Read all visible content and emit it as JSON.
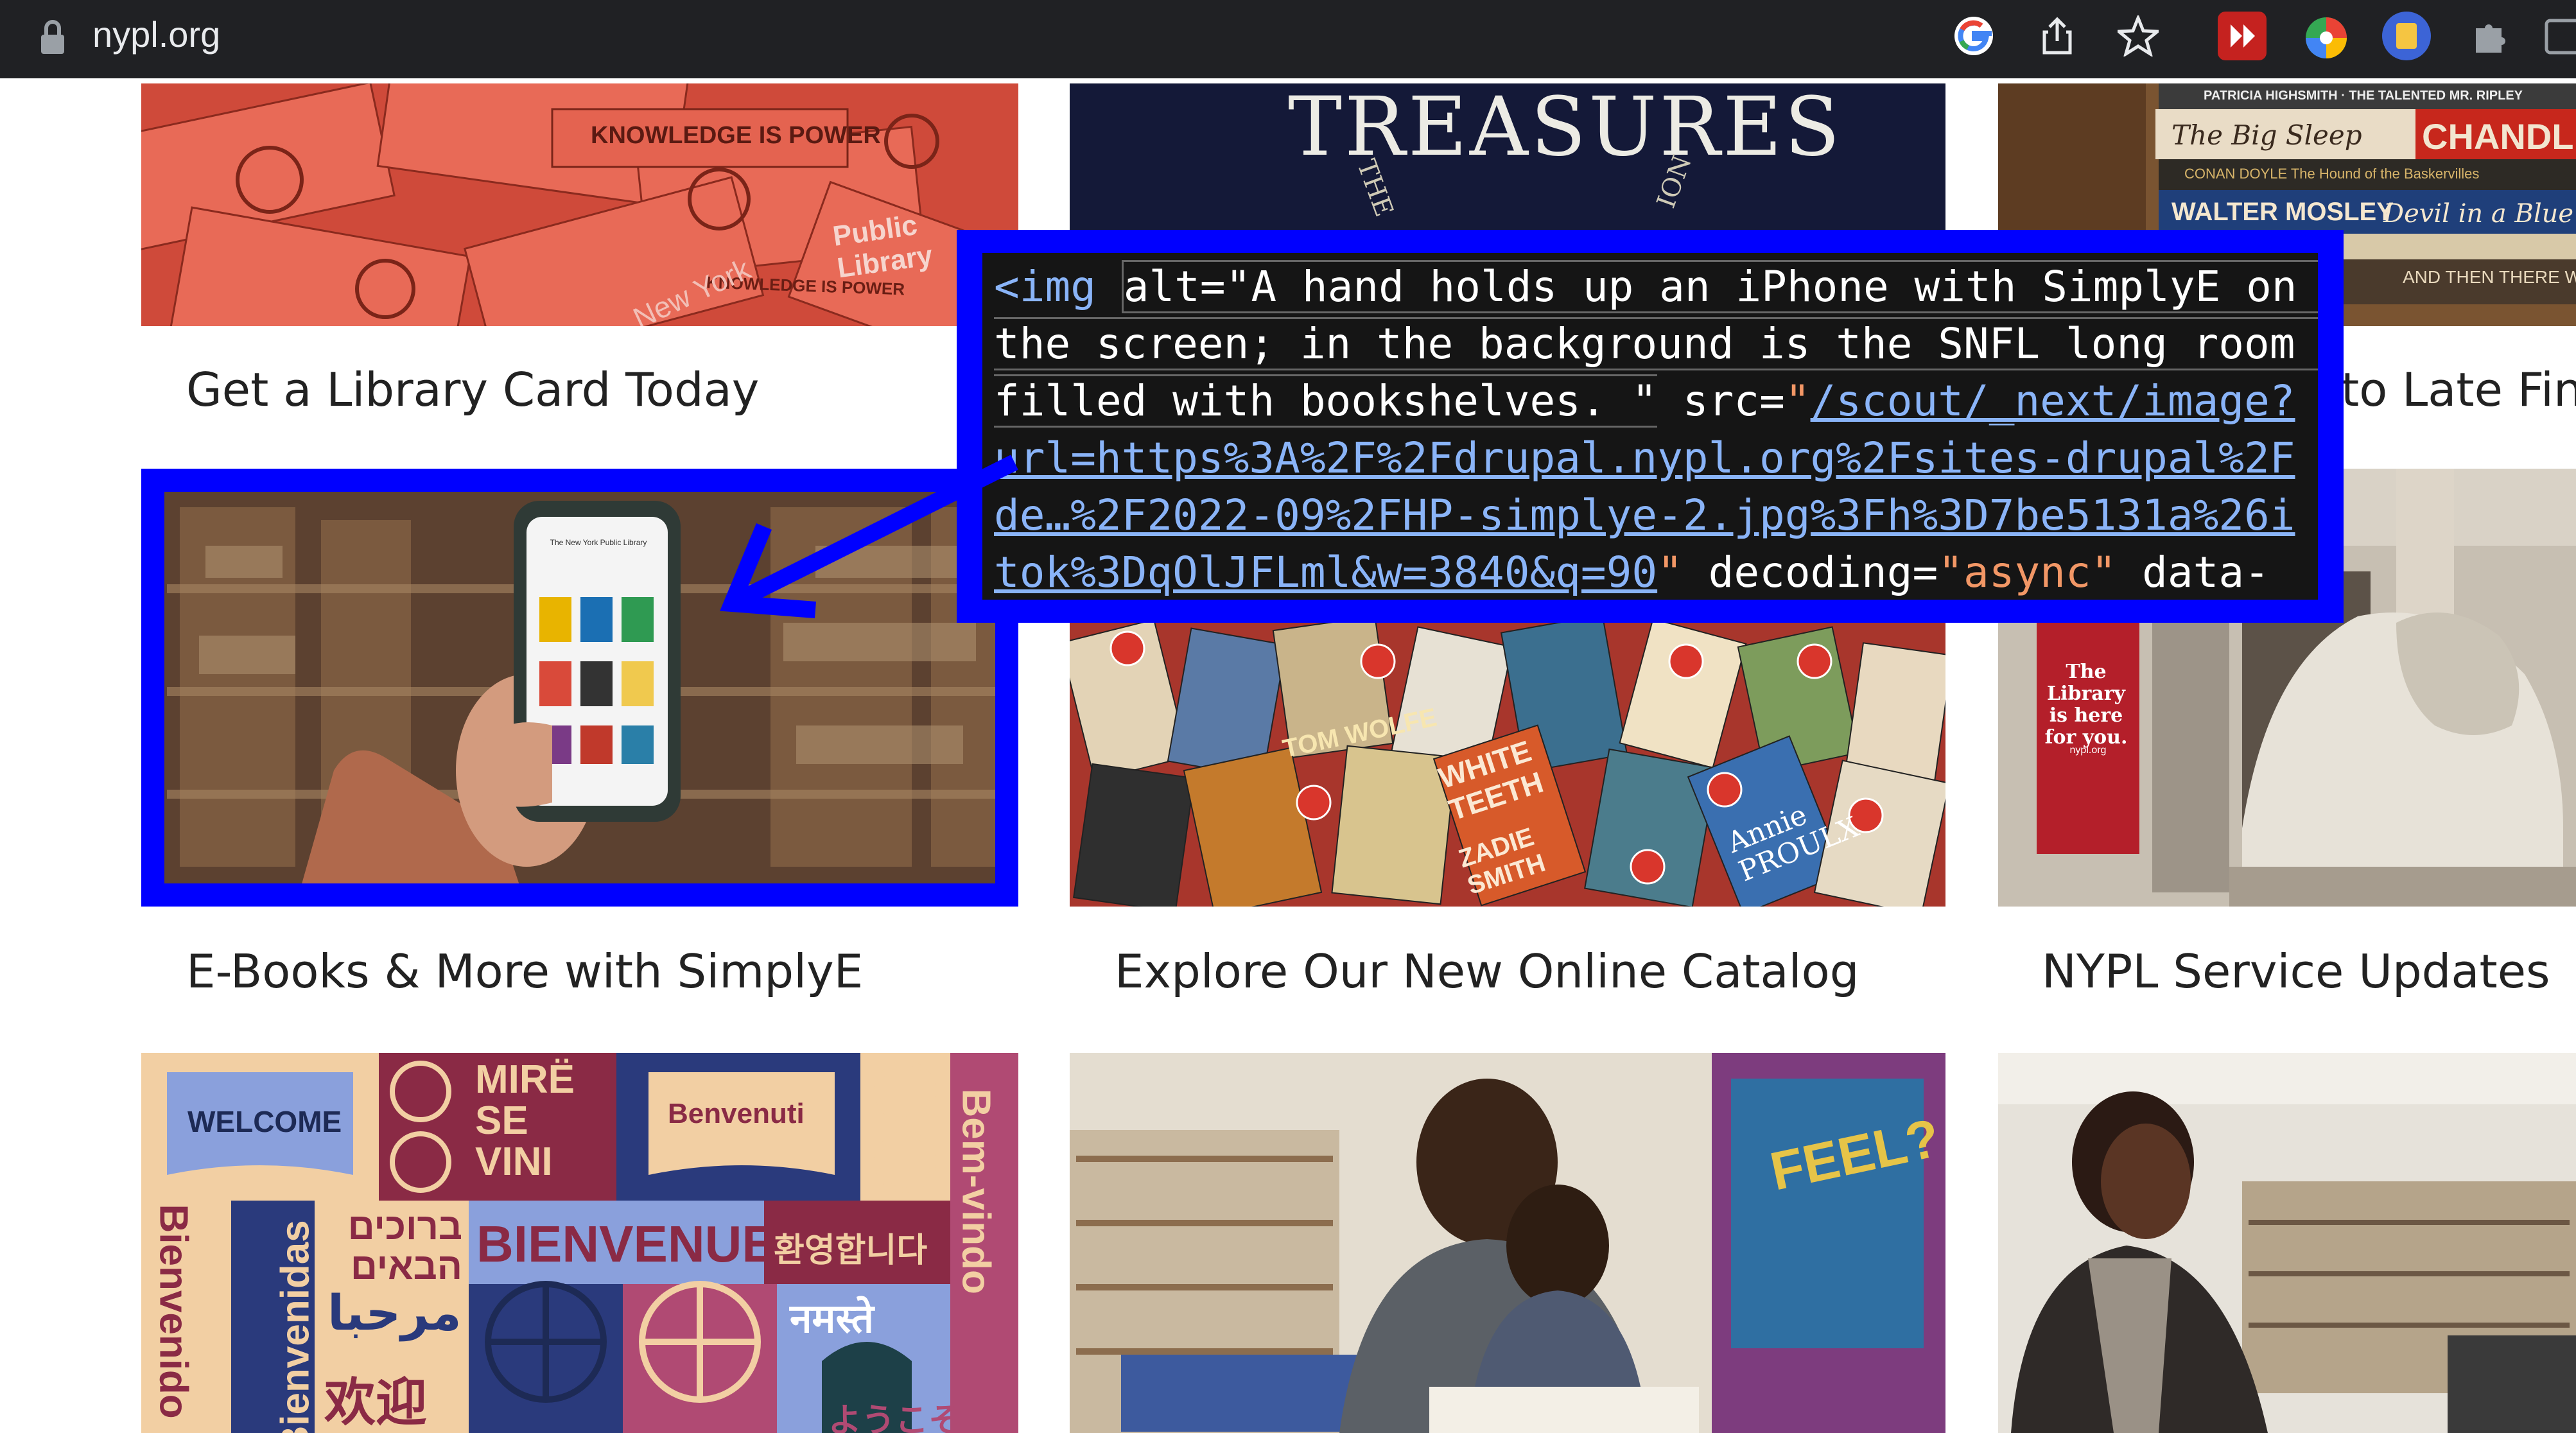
{
  "browser": {
    "url": "nypl.org",
    "icons": [
      "lock-icon",
      "google-icon",
      "share-icon",
      "bookmark-star-icon",
      "extension-red-icon",
      "extension-color-wheel-icon",
      "extension-blue-icon",
      "extensions-puzzle-icon",
      "window-icon"
    ]
  },
  "cards": [
    {
      "title": "Get a Library Card Today",
      "image_text": [
        "KNOWLEDGE IS POWER",
        "Public Library",
        "KNOWLEDGE IS POWER",
        "New York"
      ]
    },
    {
      "title": "",
      "image_text": [
        "TREASURES",
        "THE",
        "ION"
      ]
    },
    {
      "title": "to Late Fine",
      "image_text": [
        "PATRICIA HIGHSMITH · THE TALENTED MR. RIPLEY",
        "The Big Sleep",
        "CHANDLER",
        "CONAN DOYLE The Hound of the Baskervilles",
        "WALTER MOSLEY",
        "Devil in a Blue",
        "AND THEN THERE W"
      ]
    },
    {
      "title": "E-Books & More with SimplyE",
      "image_text": [
        "The New York Public Library"
      ]
    },
    {
      "title": "Explore Our New Online Catalog",
      "image_text": [
        "TOM WOLFE",
        "WHITE TEETH",
        "ZADIE SMITH",
        "Annie PROULX"
      ]
    },
    {
      "title": "NYPL Service Updates",
      "image_text": [
        "The Library is here for you.",
        "nypl.org"
      ]
    },
    {
      "title": "",
      "image_text": [
        "WELCOME",
        "MIRË SE VINI",
        "Benvenuti",
        "ברוכים הבאים",
        "BIENVENUE",
        "환영합니다",
        "مرحبا",
        "नमस्ते",
        "欢迎",
        "ようこそ",
        "Bem-vindo",
        "Bienvenidas",
        "Bienvenido"
      ]
    },
    {
      "title": "",
      "image_text": [
        "FEEL?"
      ]
    },
    {
      "title": "",
      "image_text": []
    }
  ],
  "inspector": {
    "tag_open": "<img",
    "alt_attr": "alt=",
    "alt_value": "\"A hand holds up an iPhone with SimplyE on the screen; in the background is the SNFL long room filled with bookshelves. \"",
    "src_attr": " src=",
    "src_q1": "\"",
    "src_value": "/scout/_next/image?url=https%3A%2F%2Fdrupal.nypl.org%2Fsites-drupal%2Fde…%2F2022-09%2FHP-simplye-2.jpg%3Fh%3D7be5131a%26itok%3DqOlJFLml&w=3840&q=90",
    "src_q2": "\"",
    "decoding_attr": " decoding=",
    "decoding_value": "\"async\"",
    "data_attr": " data-"
  },
  "colors": {
    "highlight": "#0000ff",
    "browser_bar": "#202124"
  }
}
